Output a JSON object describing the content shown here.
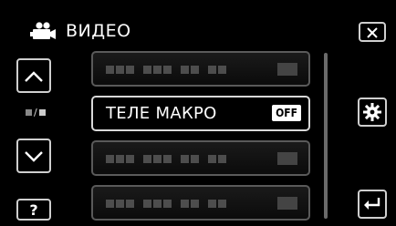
{
  "header": {
    "title": "ВИДЕО",
    "mode_icon": "video-camera-icon"
  },
  "menu": {
    "items": [
      {
        "label": "",
        "value": "",
        "state": "placeholder"
      },
      {
        "label": "ТЕЛЕ МАКРО",
        "value": "OFF",
        "state": "active"
      },
      {
        "label": "",
        "value": "",
        "state": "placeholder"
      },
      {
        "label": "",
        "value": "",
        "state": "placeholder"
      }
    ]
  },
  "nav": {
    "up_icon": "chevron-up-icon",
    "down_icon": "chevron-down-icon",
    "page_indicator": "■/■"
  },
  "buttons": {
    "close_icon": "close-icon",
    "settings_icon": "gear-icon",
    "back_icon": "return-arrow-icon",
    "help_label": "?"
  },
  "colors": {
    "background": "#000000",
    "border": "#cfcfcf",
    "inactive_item_border": "#5a5a5a",
    "placeholder_block": "#4d4d4d"
  }
}
